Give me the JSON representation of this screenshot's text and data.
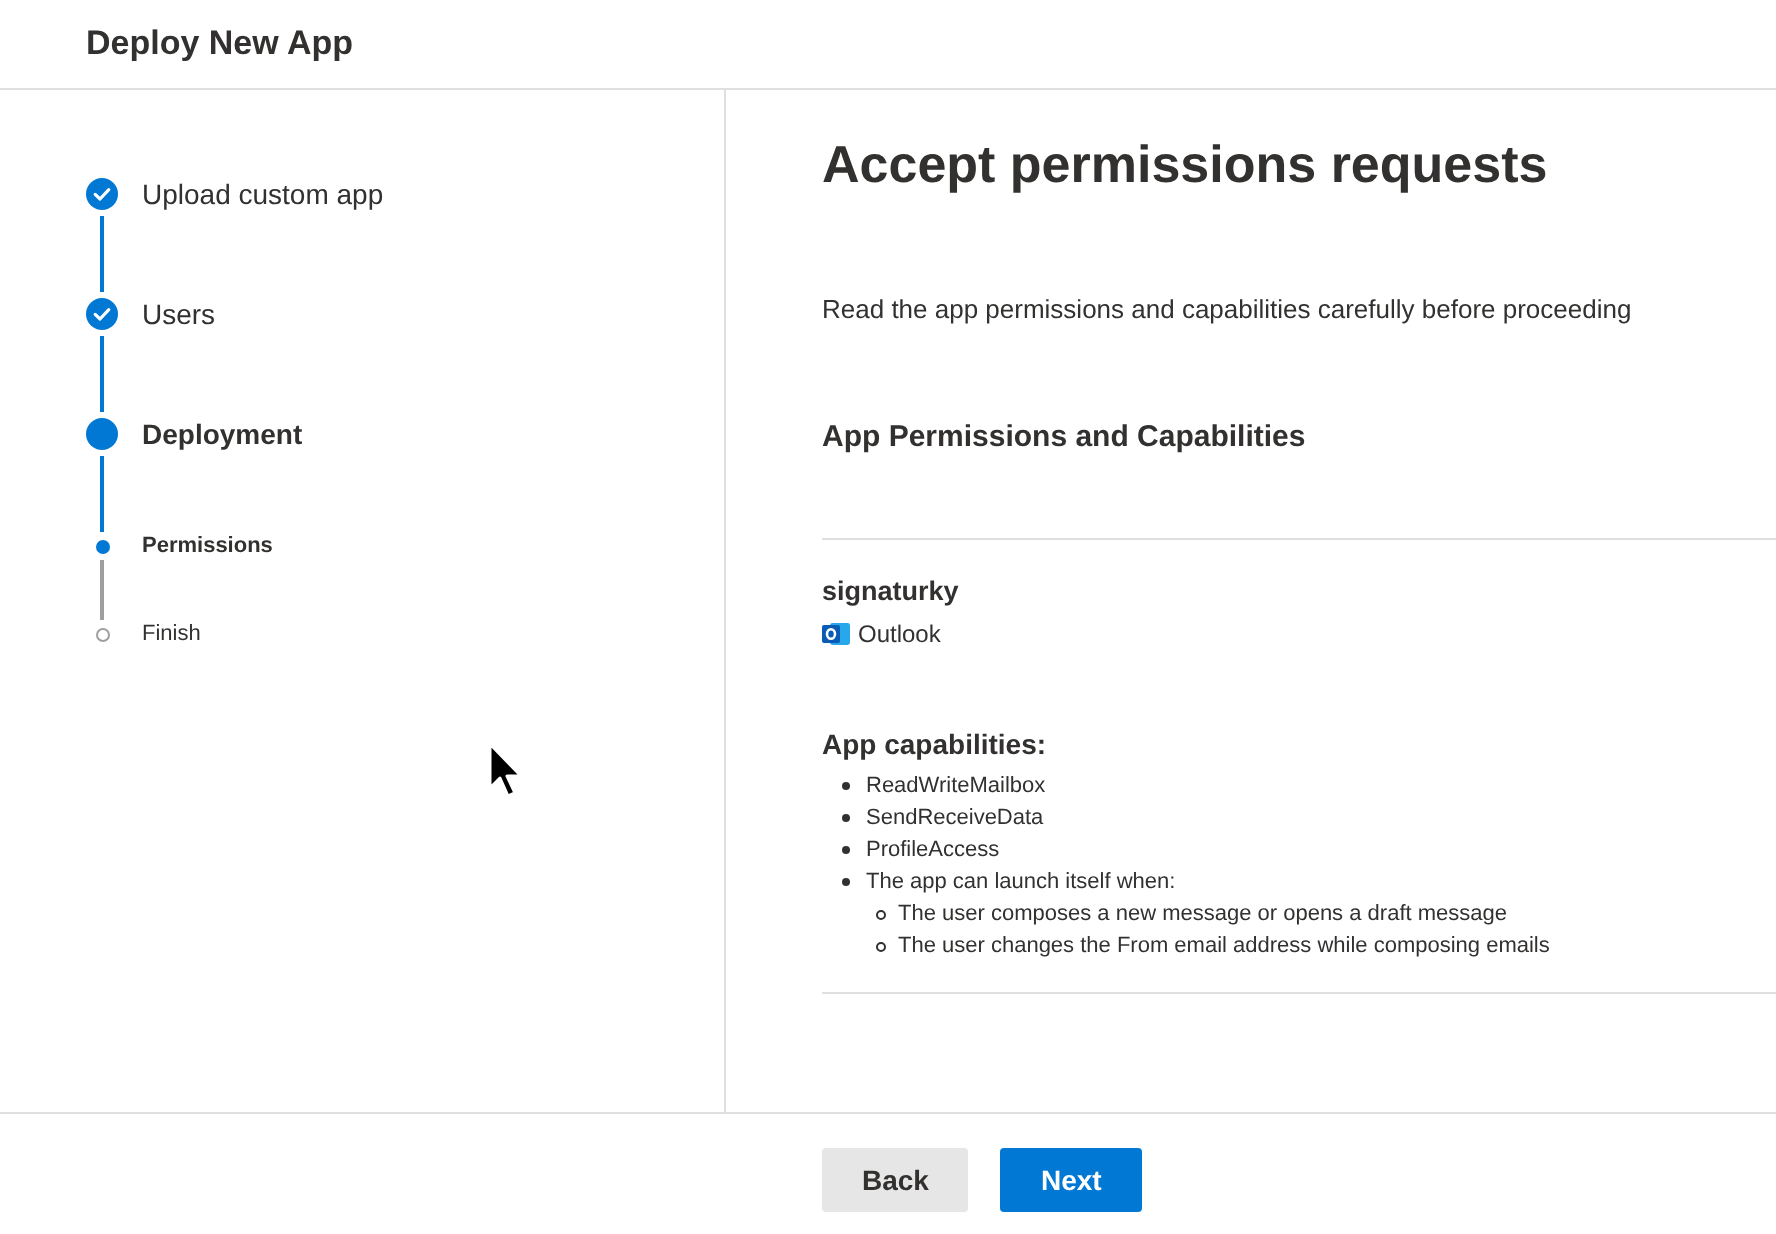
{
  "header": {
    "title": "Deploy New App"
  },
  "steps": [
    {
      "label": "Upload custom app",
      "completed": true,
      "current": false
    },
    {
      "label": "Users",
      "completed": true,
      "current": false
    },
    {
      "label": "Deployment",
      "completed": false,
      "current": true,
      "children": [
        {
          "label": "Permissions",
          "completed": false,
          "current": true
        },
        {
          "label": "Finish",
          "completed": false,
          "current": false
        }
      ]
    }
  ],
  "content": {
    "title": "Accept permissions requests",
    "description": "Read the app permissions and capabilities carefully before proceeding",
    "section_title": "App Permissions and Capabilities",
    "app": {
      "name": "signaturky",
      "host": "Outlook"
    },
    "capabilities": {
      "heading": "App capabilities:",
      "items": [
        {
          "text": "ReadWriteMailbox"
        },
        {
          "text": "SendReceiveData"
        },
        {
          "text": "ProfileAccess"
        },
        {
          "text": "The app can launch itself when:",
          "children": [
            {
              "text": "The user composes a new message or opens a draft message"
            },
            {
              "text": "The user changes the From email address while composing emails"
            }
          ]
        }
      ]
    }
  },
  "footer": {
    "buttons": [
      {
        "label": "Back",
        "kind": "secondary"
      },
      {
        "label": "Next",
        "kind": "primary"
      }
    ]
  }
}
